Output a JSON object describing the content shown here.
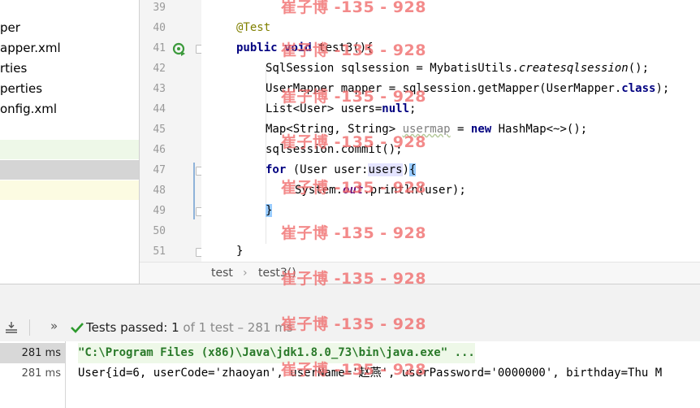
{
  "project_tree": {
    "items": [
      {
        "label": "per"
      },
      {
        "label": "apper.xml"
      },
      {
        "label": "rties"
      },
      {
        "label": "perties"
      },
      {
        "label": "onfig.xml"
      }
    ]
  },
  "editor": {
    "line_numbers": [
      "39",
      "40",
      "41",
      "42",
      "43",
      "44",
      "45",
      "46",
      "47",
      "48",
      "49",
      "50",
      "51"
    ],
    "lines": {
      "l40": "@Test",
      "l41_kw1": "public",
      "l41_kw2": "void",
      "l41_rest": " test3(){",
      "l42_a": "SqlSession sqlsession = MybatisUtils.",
      "l42_b": "createsqlsession",
      "l42_c": "();",
      "l43_a": "UserMapper mapper = sqlsession.getMapper(UserMapper.",
      "l43_b": "class",
      "l43_c": ");",
      "l44_a": "List<User> users=",
      "l44_b": "null",
      "l44_c": ";",
      "l45_a": "Map<String, String> ",
      "l45_b": "usermap",
      "l45_c": " = ",
      "l45_d": "new",
      "l45_e": " HashMap<~>();",
      "l46": "sqlsession.commit();",
      "l47_a": "for",
      "l47_b": " (User user:",
      "l47_c": "users",
      "l47_d": ")",
      "l47_e": "{",
      "l48_a": "System.",
      "l48_b": "out",
      "l48_c": ".println(user);",
      "l49": "}",
      "l51": "}"
    }
  },
  "breadcrumb": {
    "items": [
      "test",
      "test3()"
    ]
  },
  "run_panel": {
    "status_label": "Tests passed:",
    "passed_count": "1",
    "total_text": "of 1 test",
    "duration": "– 281 ms",
    "run_times": [
      "281 ms",
      "281 ms"
    ],
    "console_lines": [
      "\"C:\\Program Files (x86)\\Java\\jdk1.8.0_73\\bin\\java.exe\" ...",
      "User{id=6, userCode='zhaoyan', userName='赵燕', userPassword='0000000', birthday=Thu M"
    ]
  },
  "watermark": {
    "text": "崔子博 -135 - 928"
  },
  "colors": {
    "keyword": "#000080",
    "annotation": "#808000",
    "static_field": "#660e7a",
    "success": "#2e9a2e",
    "watermark": "#f06a6a"
  }
}
